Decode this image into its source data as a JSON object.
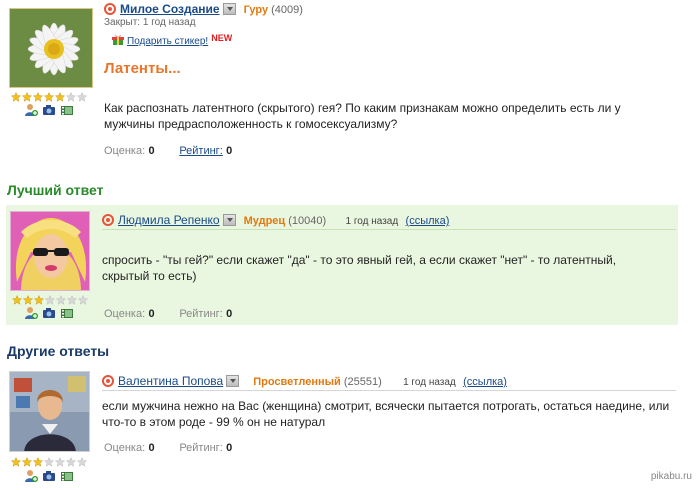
{
  "question": {
    "author": "Милое Создание",
    "rank": "Гуру",
    "points": "(4009)",
    "closed": "Закрыт: 1 год назад",
    "gift_label": "Подарить стикер!",
    "new_badge": "NEW",
    "title": "Латенты...",
    "text": "Как распознать латентного (скрытого) гея? По каким признакам можно определить есть ли у мужчины предрасположенность к гомосексуализму?",
    "score_label": "Оценка:",
    "score_value": "0",
    "rating_label": "Рейтинг:",
    "rating_value": "0",
    "stars_filled": 5
  },
  "best_answer": {
    "section_title": "Лучший ответ",
    "author": "Людмила Репенко",
    "rank": "Мудрец",
    "points": "(10040)",
    "ago": "1 год назад",
    "link": "(ссылка)",
    "text": "спросить - \"ты гей?\" если скажет \"да\" - то это явный гей, а если скажет \"нет\" - то латентный, скрытый то есть)",
    "score_label": "Оценка:",
    "score_value": "0",
    "rating_label": "Рейтинг:",
    "rating_value": "0",
    "stars_filled": 3
  },
  "other_answers": {
    "section_title": "Другие ответы",
    "items": [
      {
        "author": "Валентина Попова",
        "rank": "Просветленный",
        "points": "(25551)",
        "ago": "1 год назад",
        "link": "(ссылка)",
        "text": "если мужчина нежно на Вас (женщина) смотрит, всячески пытается потрогать, остаться наедине, или что-то в этом роде - 99 % он не натурал",
        "score_label": "Оценка:",
        "score_value": "0",
        "rating_label": "Рейтинг:",
        "rating_value": "0",
        "stars_filled": 3
      }
    ]
  },
  "watermark": "pikabu.ru",
  "colors": {
    "accent_orange": "#e8762a",
    "link_blue": "#1a4a8a",
    "best_bg": "#eaf7e0",
    "section_green": "#2a8a2a"
  }
}
